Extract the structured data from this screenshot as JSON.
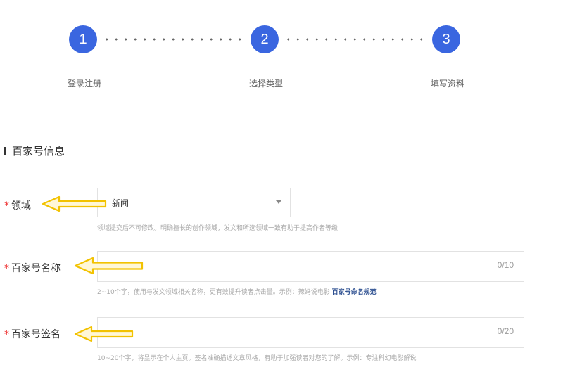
{
  "steps": [
    {
      "number": "1",
      "label": "登录注册"
    },
    {
      "number": "2",
      "label": "选择类型"
    },
    {
      "number": "3",
      "label": "填写资料"
    }
  ],
  "section": {
    "title": "百家号信息"
  },
  "fields": {
    "domain": {
      "label": "领域",
      "value": "新闻",
      "hint": "领域提交后不可修改。明确擅长的创作领域，发文和所选领域一致有助于提高作者等级"
    },
    "name": {
      "label": "百家号名称",
      "counter": "0/10",
      "hint": "2~10个字，使用与发文领域相关名称，更有效提升读者点击量。示例：辣妈说电影",
      "hint_link": "百家号命名规范"
    },
    "signature": {
      "label": "百家号签名",
      "counter": "0/20",
      "hint": "10~20个字，将显示在个人主页。签名准确描述文章风格，有助于加强读者对您的了解。示例：专注科幻电影解说"
    }
  },
  "colors": {
    "accent": "#3a66e0",
    "required": "#e33333",
    "annotation_arrow": "#f2c200"
  }
}
